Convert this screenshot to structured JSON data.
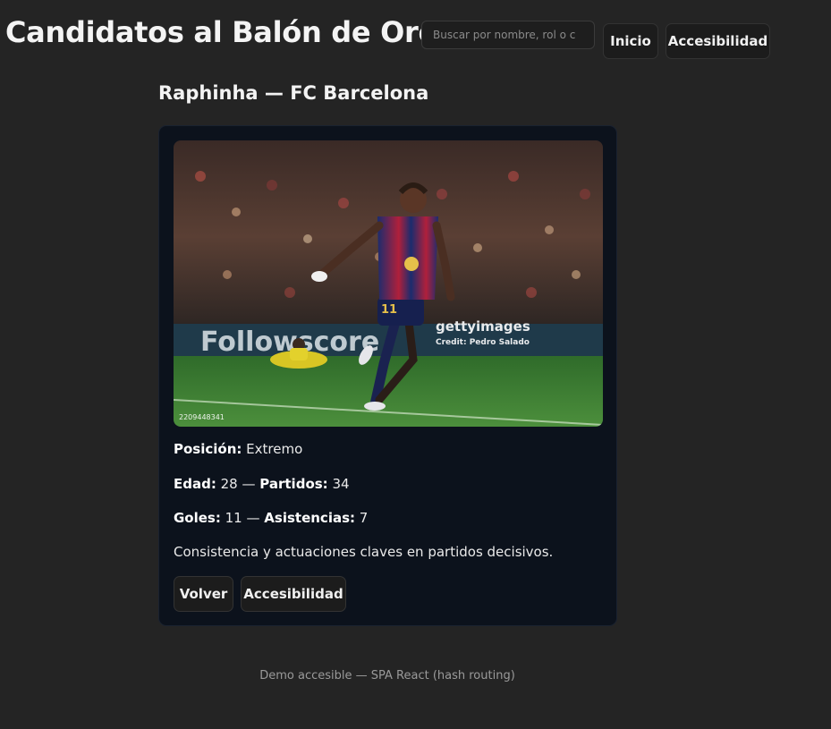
{
  "header": {
    "title": "Candidatos al Balón de Oro",
    "search_placeholder": "Buscar por nombre, rol o c",
    "nav_home_label": "Inicio",
    "nav_accessibility_label": "Accesibilidad"
  },
  "player": {
    "heading": "Raphinha — FC Barcelona",
    "photo": {
      "watermark": "gettyimages",
      "credit": "Credit: Pedro Salado",
      "image_number": "2209448341",
      "ad_board_text": "Followscore",
      "shirt_number": "11"
    },
    "position_label": "Posición:",
    "position_value": "Extremo",
    "age_label": "Edad:",
    "age_value": "28",
    "separator": "—",
    "matches_label": "Partidos:",
    "matches_value": "34",
    "goals_label": "Goles:",
    "goals_value": "11",
    "assists_label": "Asistencias:",
    "assists_value": "7",
    "description": "Consistencia y actuaciones claves en partidos decisivos.",
    "back_label": "Volver",
    "accessibility_label": "Accesibilidad"
  },
  "footer": {
    "text": "Demo accesible — SPA React (hash routing)"
  }
}
